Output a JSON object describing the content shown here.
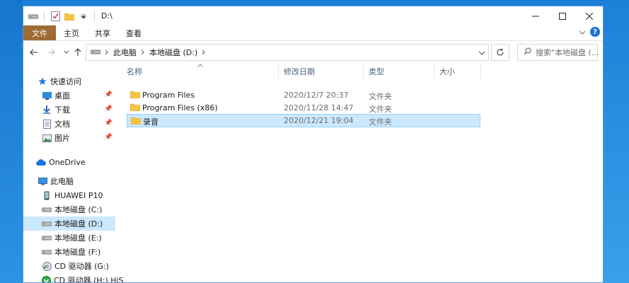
{
  "window": {
    "title": "D:\\",
    "controls": {
      "minimize": "—",
      "maximize": "☐",
      "close": "✕"
    }
  },
  "ribbon": {
    "tabs": [
      "文件",
      "主页",
      "共享",
      "查看"
    ]
  },
  "address": {
    "crumbs": [
      "此电脑",
      "本地磁盘 (D:)"
    ],
    "search_placeholder": "搜索\"本地磁盘 (..."
  },
  "sidebar": {
    "items": [
      {
        "label": "快速访问",
        "icon": "star-icon"
      },
      {
        "label": "桌面",
        "icon": "desktop-icon",
        "pinned": true
      },
      {
        "label": "下载",
        "icon": "download-icon",
        "pinned": true
      },
      {
        "label": "文档",
        "icon": "document-icon",
        "pinned": true
      },
      {
        "label": "图片",
        "icon": "picture-icon",
        "pinned": true
      },
      {
        "label": "OneDrive",
        "icon": "cloud-icon"
      },
      {
        "label": "此电脑",
        "icon": "computer-icon"
      },
      {
        "label": "HUAWEI P10",
        "icon": "phone-icon"
      },
      {
        "label": "本地磁盘 (C:)",
        "icon": "drive-icon"
      },
      {
        "label": "本地磁盘 (D:)",
        "icon": "drive-icon",
        "selected": true
      },
      {
        "label": "本地磁盘 (E:)",
        "icon": "drive-icon"
      },
      {
        "label": "本地磁盘 (F:)",
        "icon": "drive-icon"
      },
      {
        "label": "CD 驱动器 (G:)",
        "icon": "cd-drive-icon"
      },
      {
        "label": "CD 驱动器 (H:) HiS",
        "icon": "cd-drive-icon"
      }
    ]
  },
  "columns": [
    "名称",
    "修改日期",
    "类型",
    "大小"
  ],
  "files": [
    {
      "name": "Program Files",
      "date": "2020/12/7 20:37",
      "type": "文件夹",
      "size": ""
    },
    {
      "name": "Program Files (x86)",
      "date": "2020/11/28 14:47",
      "type": "文件夹",
      "size": ""
    },
    {
      "name": "录音",
      "date": "2020/12/21 19:04",
      "type": "文件夹",
      "size": "",
      "selected": true
    }
  ],
  "colors": {
    "accent": "#9e6a35",
    "selection": "#cce8ff",
    "folder": "#f5c443",
    "desktop": "#1a7fd8"
  }
}
